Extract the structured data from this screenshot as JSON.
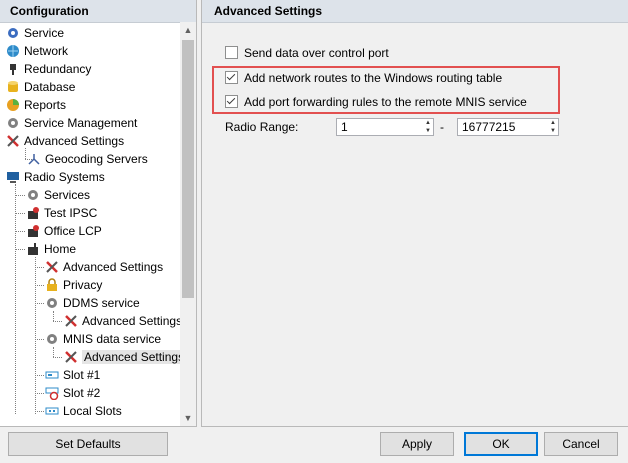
{
  "left_panel": {
    "title": "Configuration"
  },
  "tree": [
    {
      "label": "Service",
      "icon": "gear-icon",
      "color": "#3b6cc0"
    },
    {
      "label": "Network",
      "icon": "globe-icon",
      "color": "#2e8bc9"
    },
    {
      "label": "Redundancy",
      "icon": "plug-icon",
      "color": "#333333"
    },
    {
      "label": "Database",
      "icon": "database-icon",
      "color": "#e8b21e"
    },
    {
      "label": "Reports",
      "icon": "report-icon",
      "color": "#e8a020"
    },
    {
      "label": "Service Management",
      "icon": "gear-icon",
      "color": "#808080"
    },
    {
      "label": "Advanced Settings",
      "icon": "tools-icon",
      "color": "#d03030"
    },
    {
      "label": "Geocoding Servers",
      "icon": "network-icon",
      "color": "#4060a0"
    },
    {
      "label": "Radio Systems",
      "icon": "monitor-icon",
      "color": "#2060a0"
    },
    {
      "label": "Services",
      "icon": "gear-icon",
      "color": "#808080"
    },
    {
      "label": "Test IPSC",
      "icon": "radio-icon",
      "color": "#d03030"
    },
    {
      "label": "Office LCP",
      "icon": "radio-icon",
      "color": "#d03030"
    },
    {
      "label": "Home",
      "icon": "radio-icon",
      "color": "#333333"
    },
    {
      "label": "Advanced Settings",
      "icon": "tools-icon",
      "color": "#d03030"
    },
    {
      "label": "Privacy",
      "icon": "lock-icon",
      "color": "#e8b21e"
    },
    {
      "label": "DDMS service",
      "icon": "gear-icon",
      "color": "#808080"
    },
    {
      "label": "Advanced Settings",
      "icon": "tools-icon",
      "color": "#d03030"
    },
    {
      "label": "MNIS data service",
      "icon": "gear-icon",
      "color": "#808080"
    },
    {
      "label": "Advanced Settings",
      "icon": "tools-icon",
      "color": "#d03030"
    },
    {
      "label": "Slot #1",
      "icon": "slot-icon",
      "color": "#2e8bc9"
    },
    {
      "label": "Slot #2",
      "icon": "slot-disabled-icon",
      "color": "#d03030"
    },
    {
      "label": "Local Slots",
      "icon": "slots-icon",
      "color": "#2e8bc9"
    }
  ],
  "right_panel": {
    "title": "Advanced Settings",
    "send_data_label": "Send data over control port",
    "send_data_checked": false,
    "add_routes_label": "Add network routes to the Windows routing table",
    "add_routes_checked": true,
    "port_forward_label": "Add port forwarding rules to the remote MNIS service",
    "port_forward_checked": true,
    "radio_range_label": "Radio Range:",
    "range_from": "1",
    "range_sep": "-",
    "range_to": "16777215"
  },
  "buttons": {
    "set_defaults": "Set Defaults",
    "apply": "Apply",
    "ok": "OK",
    "cancel": "Cancel"
  },
  "colors": {
    "highlight_border": "#e25050",
    "header_bg": "#dde3ea"
  }
}
